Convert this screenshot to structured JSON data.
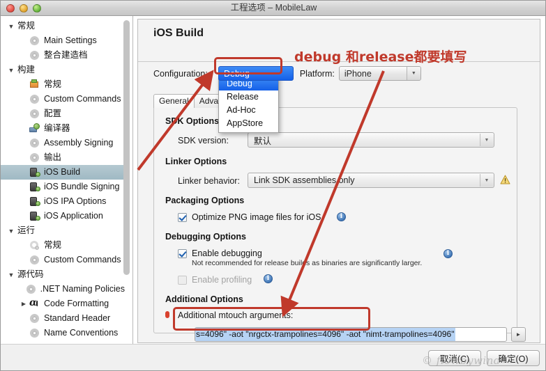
{
  "window": {
    "title": "工程选项 – MobileLaw",
    "controls": [
      "close",
      "minimize",
      "zoom"
    ]
  },
  "sidebar": {
    "items": [
      {
        "label": "常规",
        "level": 0,
        "icon": "disclosure-open",
        "expanded": true,
        "selected": false
      },
      {
        "label": "Main Settings",
        "level": 1,
        "icon": "gear-icon",
        "selected": false
      },
      {
        "label": "整合建造档",
        "level": 1,
        "icon": "gear-icon",
        "selected": false
      },
      {
        "label": "构建",
        "level": 0,
        "icon": "disclosure-open",
        "expanded": true,
        "selected": false
      },
      {
        "label": "常规",
        "level": 1,
        "icon": "build-icon",
        "selected": false
      },
      {
        "label": "Custom Commands",
        "level": 1,
        "icon": "gear-icon",
        "selected": false
      },
      {
        "label": "配置",
        "level": 1,
        "icon": "gear-icon",
        "selected": false
      },
      {
        "label": "编译器",
        "level": 1,
        "icon": "compiler-icon",
        "selected": false
      },
      {
        "label": "Assembly Signing",
        "level": 1,
        "icon": "gear-icon",
        "selected": false
      },
      {
        "label": "输出",
        "level": 1,
        "icon": "gear-icon",
        "selected": false
      },
      {
        "label": "iOS Build",
        "level": 1,
        "icon": "ios-device-icon",
        "selected": true
      },
      {
        "label": "iOS Bundle Signing",
        "level": 1,
        "icon": "ios-device-icon",
        "selected": false
      },
      {
        "label": "iOS IPA Options",
        "level": 1,
        "icon": "ios-device-icon",
        "selected": false
      },
      {
        "label": "iOS Application",
        "level": 1,
        "icon": "ios-device-icon",
        "selected": false
      },
      {
        "label": "运行",
        "level": 0,
        "icon": "disclosure-open",
        "expanded": true,
        "selected": false
      },
      {
        "label": "常规",
        "level": 1,
        "icon": "run-gear-icon",
        "selected": false
      },
      {
        "label": "Custom Commands",
        "level": 1,
        "icon": "gear-icon",
        "selected": false
      },
      {
        "label": "源代码",
        "level": 0,
        "icon": "disclosure-open",
        "expanded": true,
        "selected": false
      },
      {
        "label": ".NET Naming Policies",
        "level": 1,
        "icon": "gear-icon",
        "selected": false
      },
      {
        "label": "Code Formatting",
        "level": 1,
        "icon": "code-format-icon",
        "expandable": true,
        "selected": false
      },
      {
        "label": "Standard Header",
        "level": 1,
        "icon": "gear-icon",
        "selected": false
      },
      {
        "label": "Name Conventions",
        "level": 1,
        "icon": "gear-icon",
        "selected": false
      }
    ]
  },
  "main": {
    "page_title": "iOS Build",
    "configuration": {
      "label": "Configuration:",
      "value": "Debug",
      "options": [
        "Debug",
        "Release",
        "Ad-Hoc",
        "AppStore"
      ],
      "menu_open": true
    },
    "platform": {
      "label": "Platform:",
      "value": "iPhone"
    },
    "tabs": [
      {
        "label": "General",
        "active": true
      },
      {
        "label": "Advanced",
        "active": false
      }
    ],
    "sections": {
      "sdk_options": {
        "heading": "SDK Options",
        "sdk_version": {
          "label": "SDK version:",
          "value": "默认"
        }
      },
      "linker_options": {
        "heading": "Linker Options",
        "linker_behavior": {
          "label": "Linker behavior:",
          "value": "Link SDK assemblies only"
        },
        "warning_icon": "warning-triangle-icon"
      },
      "packaging_options": {
        "heading": "Packaging Options",
        "optimize_png": {
          "label": "Optimize PNG image files for iOS",
          "checked": true,
          "info": "info-icon"
        }
      },
      "debugging_options": {
        "heading": "Debugging Options",
        "enable_debugging": {
          "label": "Enable debugging",
          "sublabel": "Not recommended for release builds as binaries are significantly larger.",
          "checked": true,
          "info": "info-icon"
        },
        "enable_profiling": {
          "label": "Enable profiling",
          "checked": false,
          "disabled": true,
          "info": "info-icon"
        }
      },
      "additional_options": {
        "heading": "Additional Options",
        "mtouch": {
          "label": "Additional mtouch arguments:",
          "value": "s=4096\"  -aot \"nrgctx-trampolines=4096\"   -aot \"nimt-trampolines=4096\"",
          "selected": true,
          "expand_button": "expand-arrow-icon"
        }
      }
    }
  },
  "footer": {
    "cancel_label": "取消(C)",
    "ok_label": "确定(O)",
    "watermark": "© flowbywind"
  },
  "annotations": {
    "note_text": "debug 和release都要填写",
    "color": "#c0392b",
    "highlight_boxes": [
      "configuration-dropdown",
      "mtouch-arguments-field"
    ]
  }
}
